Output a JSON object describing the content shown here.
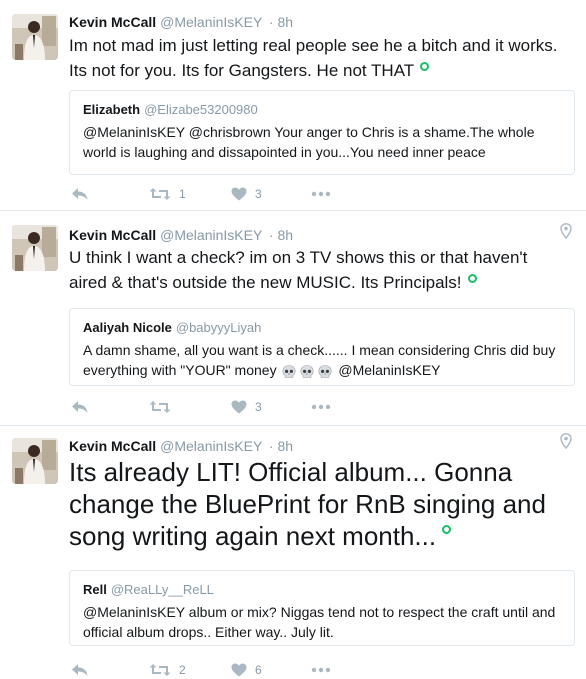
{
  "tweets": [
    {
      "name": "Kevin McCall",
      "handle": "@MelaninIsKEY",
      "time": "· 8h",
      "text": "Im not mad im just letting real people see he a bitch and it works. Its not for you. Its for Gangsters. He not THAT",
      "quote": {
        "name": "Elizabeth",
        "handle": "@Elizabe53200980",
        "text": "@MelaninIsKEY @chrisbrown Your anger to Chris is a shame.The whole world is laughing and dissapointed in you...You need inner peace"
      },
      "retweets": "1",
      "likes": "3",
      "pinned": false
    },
    {
      "name": "Kevin McCall",
      "handle": "@MelaninIsKEY",
      "time": "· 8h",
      "text": "U think I want a check? im on 3 TV shows this or that haven't aired & that's outside the new MUSIC. Its Principals!",
      "quote": {
        "name": "Aaliyah Nicole",
        "handle": "@babyyyLiyah",
        "text_before": "A damn shame, all you want is a check...... I mean considering Chris did buy everything with \"YOUR\" money",
        "text_after": "@MelaninIsKEY"
      },
      "retweets": "",
      "likes": "3",
      "pinned": true
    },
    {
      "name": "Kevin McCall",
      "handle": "@MelaninIsKEY",
      "time": "· 8h",
      "text": "Its already LIT! Official album... Gonna change the BluePrint for RnB singing and song writing again next month...",
      "quote": {
        "name": "Rell",
        "handle": "@ReaLLy__ReLL",
        "text": "@MelaninIsKEY album or mix? Niggas tend not to respect the craft until and official album drops.. Either way.. July lit."
      },
      "retweets": "2",
      "likes": "6",
      "pinned": true
    }
  ],
  "icons": {
    "reply": "reply-icon",
    "retweet": "retweet-icon",
    "like": "heart-icon",
    "more": "more-icon",
    "pin": "location-pin-icon",
    "status": "green-circle-icon",
    "skull": "skull-emoji-icon"
  },
  "colors": {
    "icon_gray": "#aab8c2",
    "status_green": "#17bf63",
    "divider": "#e1e8ed"
  }
}
